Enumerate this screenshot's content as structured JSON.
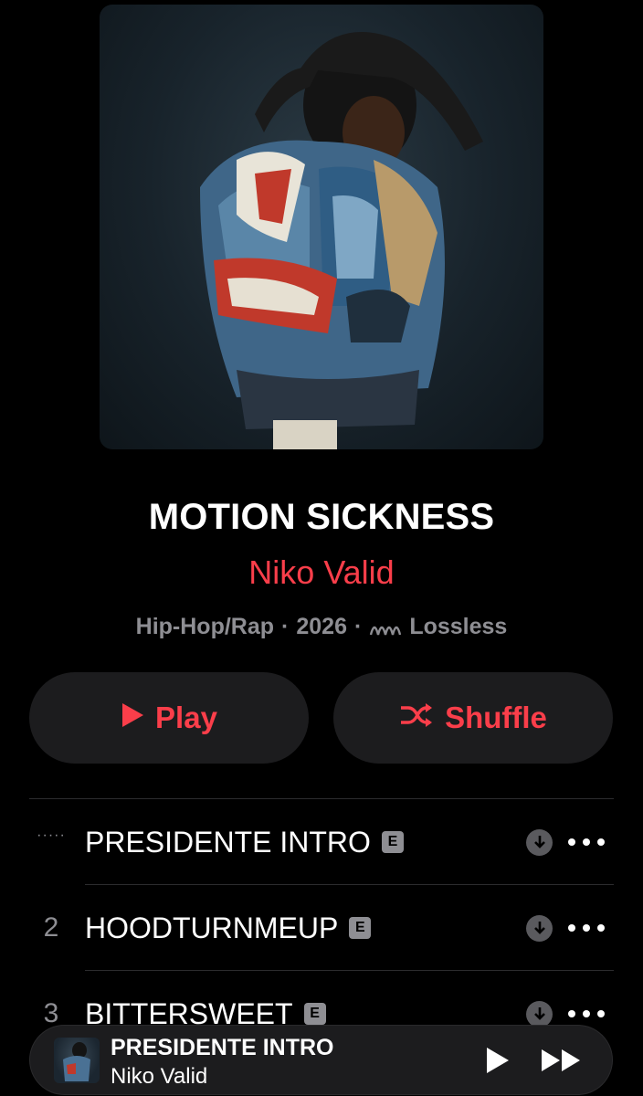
{
  "album": {
    "title": "MOTION SICKNESS",
    "artist": "Niko Valid",
    "genre": "Hip-Hop/Rap",
    "year": "2026",
    "separator": "·",
    "quality_label": "Lossless",
    "artwork_icon": "album-artwork-image"
  },
  "actions": {
    "play_label": "Play",
    "shuffle_label": "Shuffle",
    "accent_color": "#fa3e4a"
  },
  "tracks": [
    {
      "number": "·····",
      "title": "PRESIDENTE INTRO",
      "explicit": "E",
      "playing": true
    },
    {
      "number": "2",
      "title": "HOODTURNMEUP",
      "explicit": "E",
      "playing": false
    },
    {
      "number": "3",
      "title": "BITTERSWEET",
      "explicit": "E",
      "playing": false
    }
  ],
  "now_playing": {
    "title": "PRESIDENTE INTRO",
    "artist": "Niko Valid"
  }
}
